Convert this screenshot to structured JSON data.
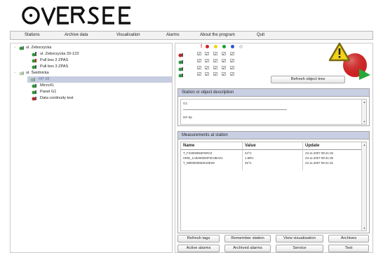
{
  "app": {
    "logo_text": "OVERSEE"
  },
  "menu": [
    {
      "label": "Stations"
    },
    {
      "label": "Archive data"
    },
    {
      "label": "Visualisation"
    },
    {
      "label": "Alarms"
    },
    {
      "label": "About the program"
    },
    {
      "label": "Quit"
    }
  ],
  "tree": {
    "items": [
      {
        "label": "ul. Zeborzycka",
        "level": 0
      },
      {
        "label": "ul. Zeborzycka 20-123",
        "level": 1
      },
      {
        "label": "Pull box 2 ZPAS",
        "level": 1
      },
      {
        "label": "Pull box 3 ZPAS",
        "level": 1
      },
      {
        "label": "ul. Świdnicka",
        "level": 0
      },
      {
        "label": "RP 98",
        "level": 1,
        "selected": true
      },
      {
        "label": "MicroXL",
        "level": 1
      },
      {
        "label": "Panel G1",
        "level": 1
      },
      {
        "label": "Data continuity test",
        "level": 1
      }
    ]
  },
  "toolbar": {
    "refresh_tree": "Refresh object tree"
  },
  "description": {
    "title": "Station or object description",
    "line1": "G1",
    "line2": "RP 98"
  },
  "measurements": {
    "title": "Measurements at station",
    "headers": [
      "Name",
      "Value",
      "Update"
    ],
    "rows": [
      [
        "T_F43000863F6RC0",
        "24°C",
        "23.11.2007 09:41:26"
      ],
      [
        "HMD_1A6000000F0C0BA0A",
        "1.88%",
        "23.11.2007 09:41:36"
      ],
      [
        "T_9800000863010E28",
        "25°C",
        "23.11.2007 09:41:31"
      ]
    ]
  },
  "buttons": {
    "refresh_tags": "Refresh tags",
    "remember_station": "Remember station",
    "view_visualisation": "View visualisation",
    "archives": "Archives",
    "active_alarms": "Active alarms",
    "archived_alarms": "Archived alarms",
    "service": "Service",
    "test": "Test"
  },
  "colors": {
    "accent_panel": "#c9cfe3",
    "status_red": "#d82020",
    "status_yellow": "#f2d21a",
    "status_green": "#18a030",
    "status_blue": "#2a57c8"
  }
}
